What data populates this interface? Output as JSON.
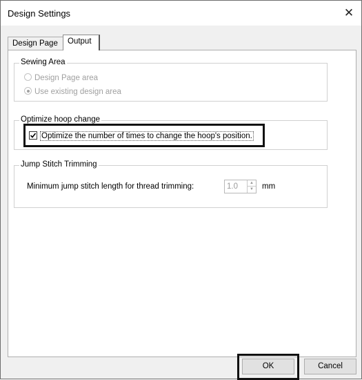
{
  "window": {
    "title": "Design Settings",
    "close_glyph": "✕"
  },
  "tabs": [
    {
      "label": "Design Page",
      "active": false
    },
    {
      "label": "Output",
      "active": true
    }
  ],
  "sewing_area": {
    "legend": "Sewing Area",
    "options": [
      {
        "label": "Design Page area",
        "selected": false
      },
      {
        "label": "Use existing design area",
        "selected": true
      }
    ]
  },
  "optimize": {
    "legend": "Optimize hoop change",
    "checkbox_label": "Optimize the number of times to change the hoop's position.",
    "checked": true
  },
  "jump": {
    "legend": "Jump Stitch Trimming",
    "label": "Minimum jump stitch length for thread trimming:",
    "value": "1.0",
    "unit": "mm"
  },
  "buttons": {
    "ok": "OK",
    "cancel": "Cancel"
  },
  "icons": {
    "close": "close-icon",
    "spin_up": "▲",
    "spin_down": "▼"
  }
}
